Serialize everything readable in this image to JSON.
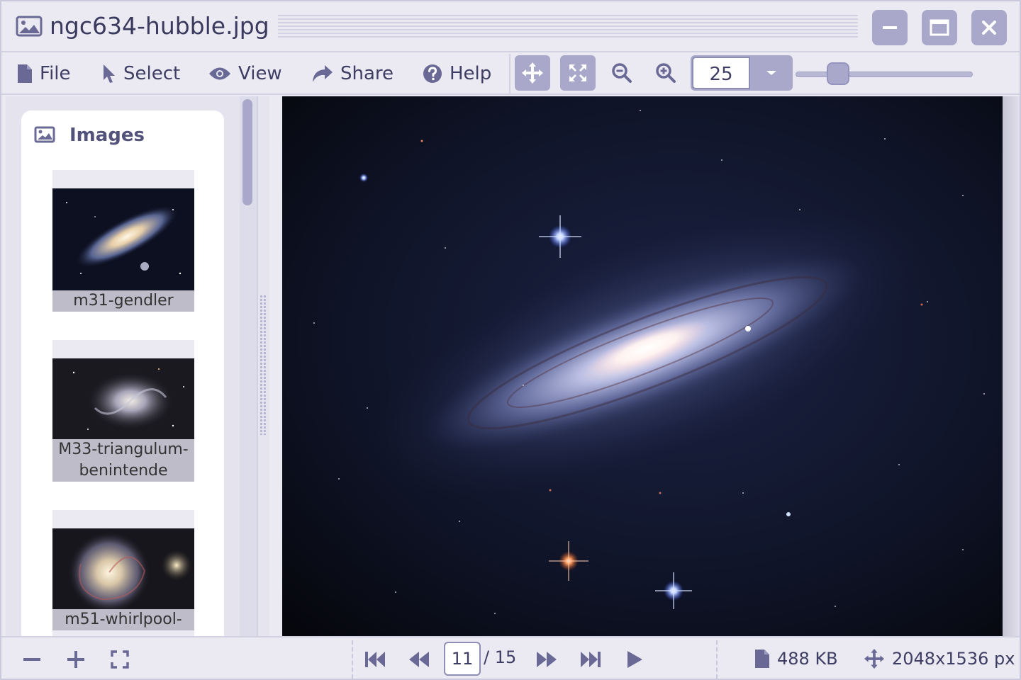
{
  "window": {
    "title": "ngc634-hubble.jpg"
  },
  "menu": {
    "items": [
      {
        "label": "File",
        "icon": "file-icon"
      },
      {
        "label": "Select",
        "icon": "cursor-icon"
      },
      {
        "label": "View",
        "icon": "eye-icon"
      },
      {
        "label": "Share",
        "icon": "share-icon"
      },
      {
        "label": "Help",
        "icon": "help-icon"
      }
    ]
  },
  "toolbar": {
    "zoom_value": "25",
    "zoom_slider_fraction": 0.24
  },
  "sidebar": {
    "title": "Images",
    "thumbnails": [
      {
        "label": "m31-gendler"
      },
      {
        "label": "M33-triangulum-benintende"
      },
      {
        "label": "m51-whirlpool-"
      }
    ]
  },
  "statusbar": {
    "current_page": "11",
    "total_pages": "/ 15",
    "file_size": "488 KB",
    "dimensions": "2048x1536 px"
  },
  "colors": {
    "accent": "#a9a8cb",
    "icon": "#6a6996",
    "text": "#3e3d63",
    "background": "#ebeaf2"
  }
}
